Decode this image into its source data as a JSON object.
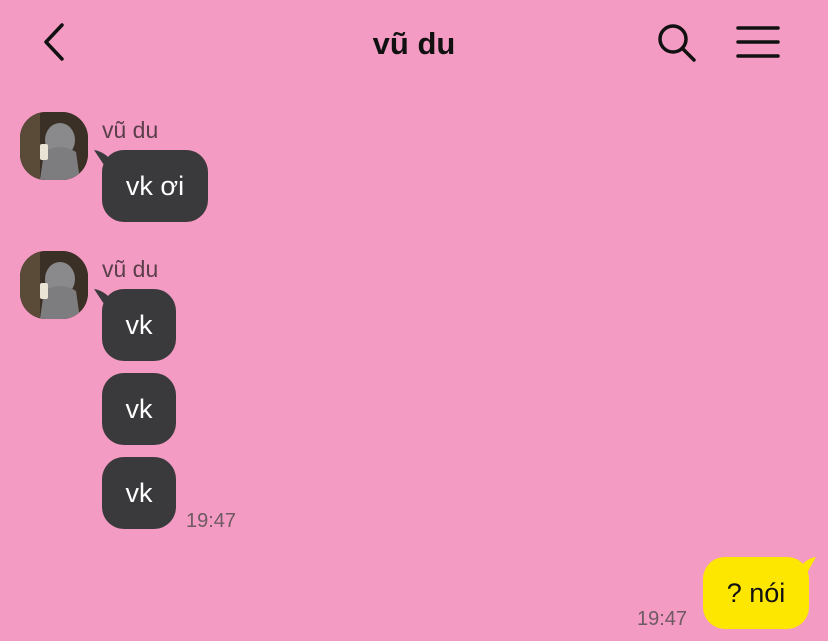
{
  "header": {
    "title": "vũ du",
    "back_icon": "chevron-left-icon",
    "search_icon": "search-icon",
    "menu_icon": "hamburger-menu-icon"
  },
  "colors": {
    "background": "#f39bc2",
    "incoming_bubble": "#3a3a3c",
    "outgoing_bubble": "#fde700"
  },
  "messages": {
    "group1": {
      "sender": "vũ du",
      "items": [
        "vk ơi"
      ]
    },
    "group2": {
      "sender": "vũ du",
      "items": [
        "vk",
        "vk",
        "vk"
      ],
      "time": "19:47"
    },
    "outgoing": {
      "text": "? nói",
      "time": "19:47"
    }
  }
}
